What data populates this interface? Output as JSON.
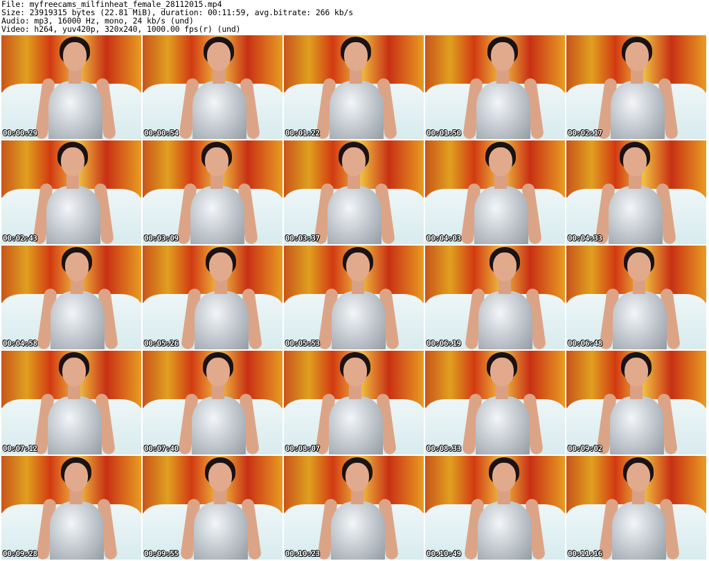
{
  "header": {
    "file": "File: myfreecams_milfinheat_female_28112015.mp4",
    "size": "Size: 23919315 bytes (22.81 MiB), duration: 00:11:59, avg.bitrate: 266 kb/s",
    "audio": "Audio: mp3, 16000 Hz, mono, 24 kb/s (und)",
    "video": "Video: h264, yuv420p, 320x240, 1000.00 fps(r) (und)"
  },
  "thumbnails": [
    {
      "timestamp": "00:00:29"
    },
    {
      "timestamp": "00:00:54"
    },
    {
      "timestamp": "00:01:22"
    },
    {
      "timestamp": "00:01:50"
    },
    {
      "timestamp": "00:02:17"
    },
    {
      "timestamp": "00:02:43"
    },
    {
      "timestamp": "00:03:09"
    },
    {
      "timestamp": "00:03:37"
    },
    {
      "timestamp": "00:04:03"
    },
    {
      "timestamp": "00:04:33"
    },
    {
      "timestamp": "00:04:58"
    },
    {
      "timestamp": "00:05:26"
    },
    {
      "timestamp": "00:05:53"
    },
    {
      "timestamp": "00:06:19"
    },
    {
      "timestamp": "00:06:48"
    },
    {
      "timestamp": "00:07:12"
    },
    {
      "timestamp": "00:07:40"
    },
    {
      "timestamp": "00:08:07"
    },
    {
      "timestamp": "00:08:33"
    },
    {
      "timestamp": "00:09:02"
    },
    {
      "timestamp": "00:09:28"
    },
    {
      "timestamp": "00:09:55"
    },
    {
      "timestamp": "00:10:23"
    },
    {
      "timestamp": "00:10:49"
    },
    {
      "timestamp": "00:11:16"
    }
  ]
}
